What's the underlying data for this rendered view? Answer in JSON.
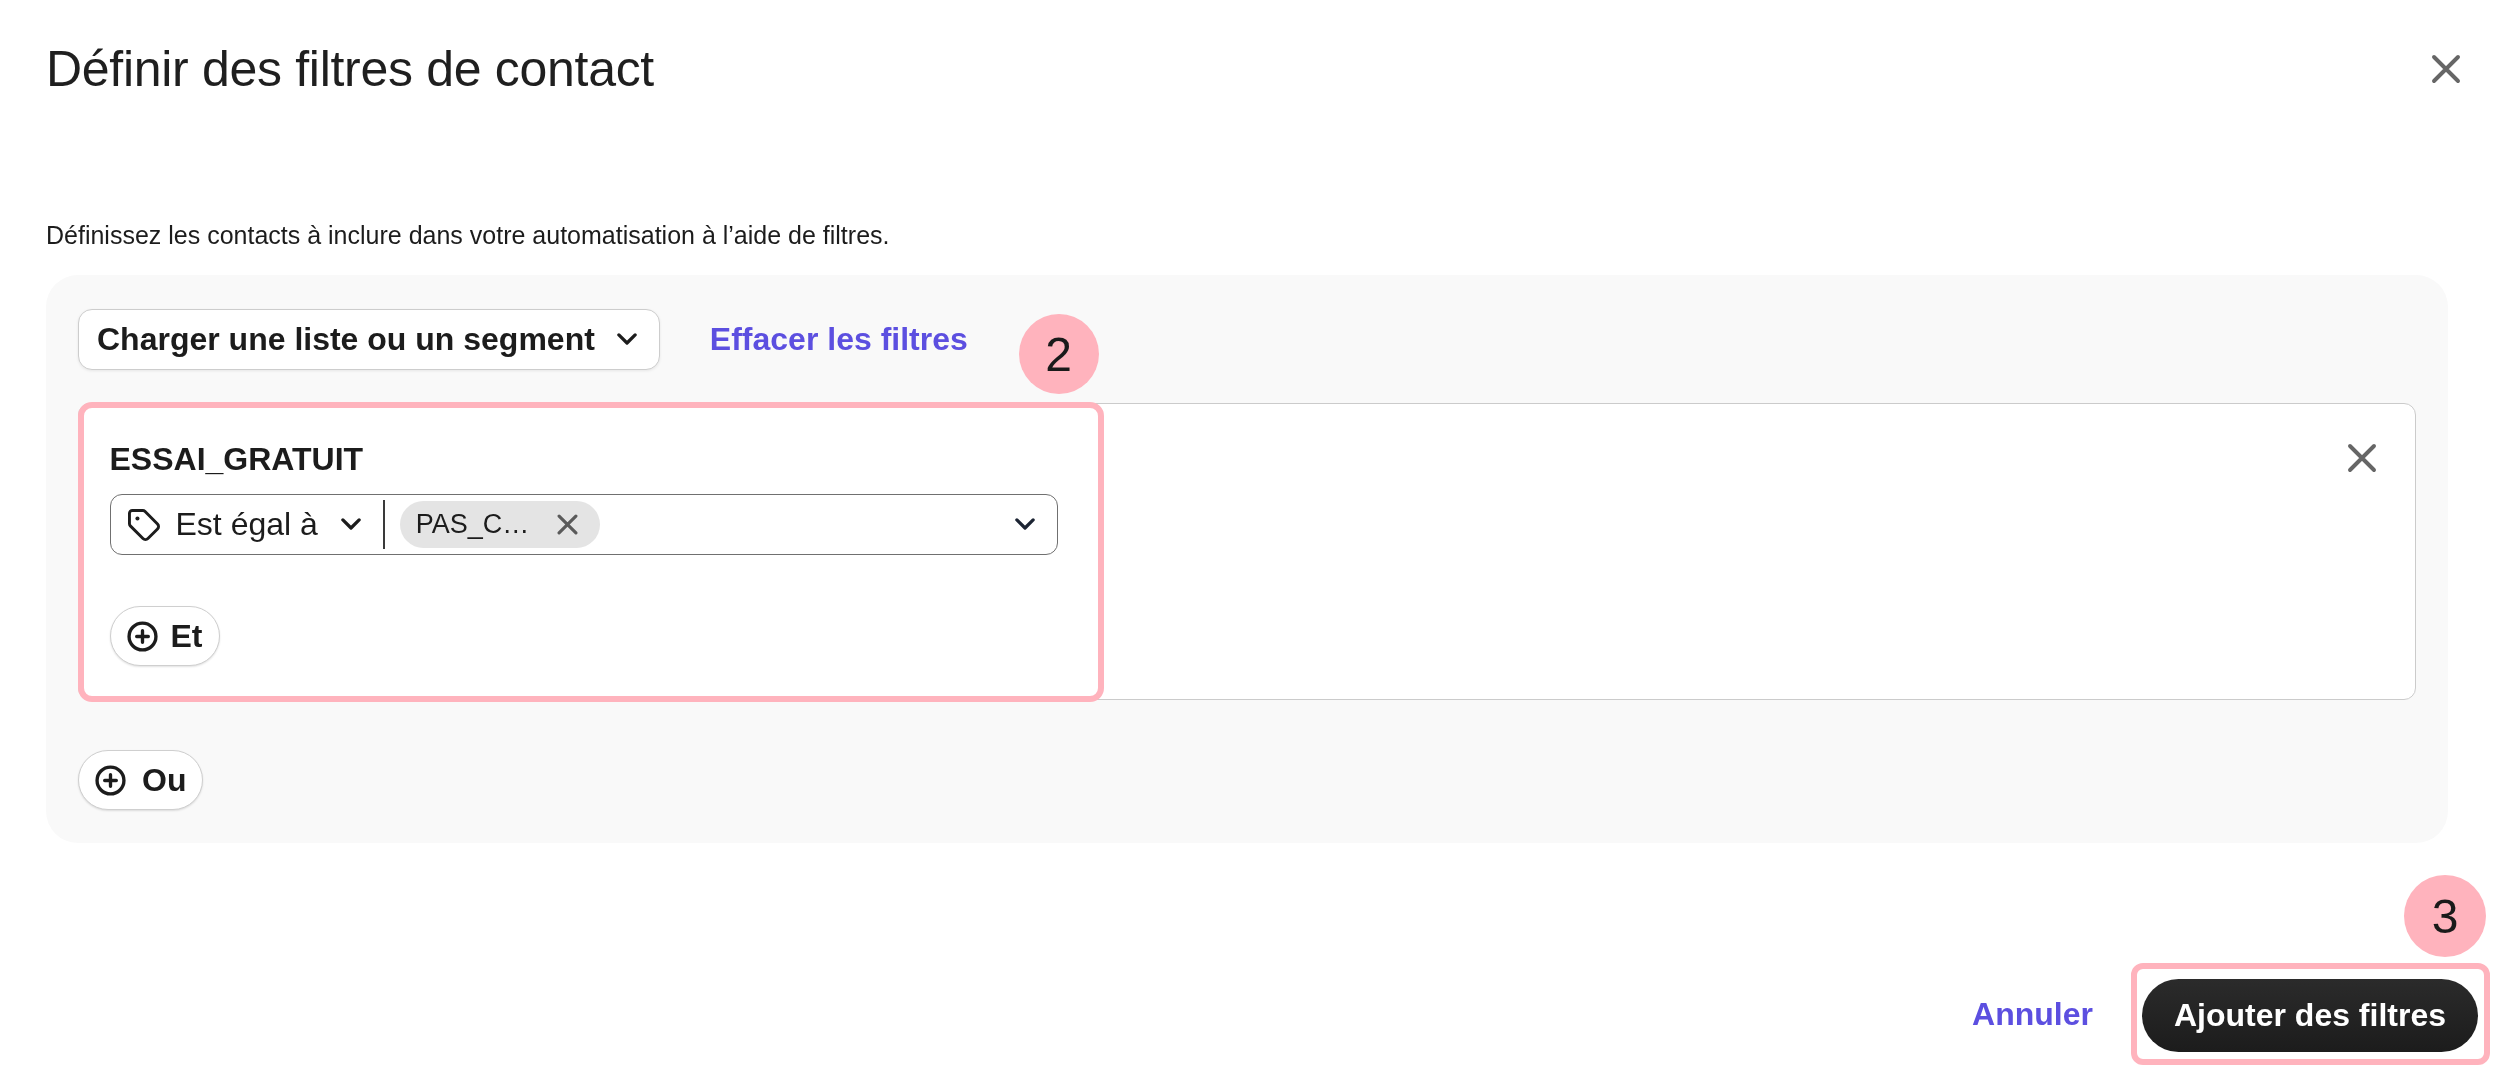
{
  "dialog": {
    "title": "Définir des filtres de contact",
    "description": "Définissez les contacts à inclure dans votre automatisation à l’aide de filtres."
  },
  "toolbar": {
    "source_dropdown": "Charger une liste ou un segment",
    "clear_link": "Effacer les filtres"
  },
  "filter_groups": [
    {
      "callout": "2",
      "conditions": [
        {
          "field": "ESSAI_GRATUIT",
          "operator": "Est égal à",
          "values": [
            "PAS_C…"
          ]
        }
      ],
      "and_button": "Et"
    }
  ],
  "or_button": "Ou",
  "footer": {
    "cancel_link": "Annuler",
    "submit_button": {
      "label": "Ajouter des filtres",
      "callout": "3"
    }
  }
}
